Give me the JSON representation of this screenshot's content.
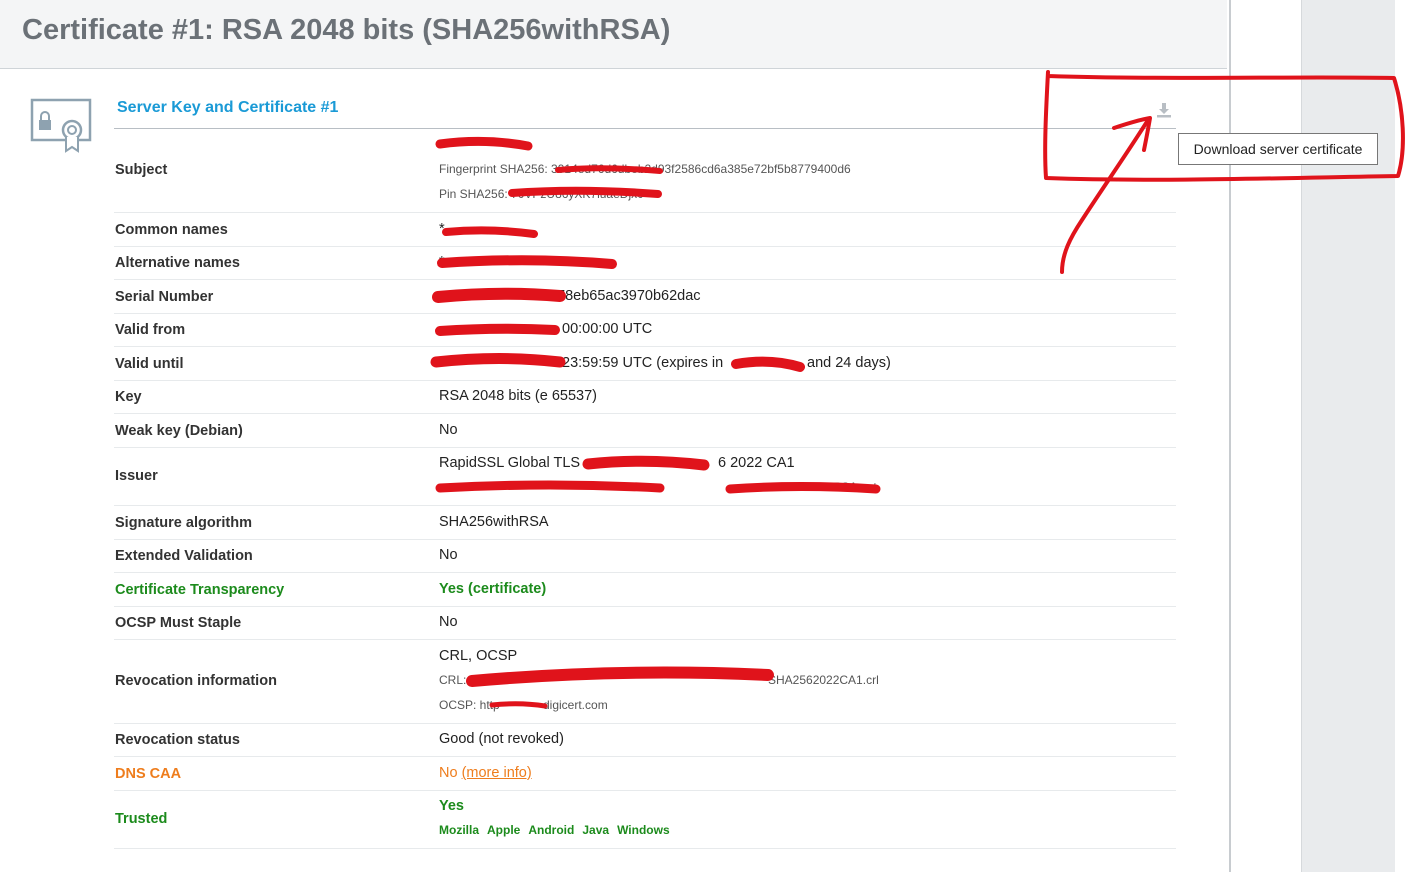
{
  "header": {
    "title": "Certificate #1: RSA 2048 bits (SHA256withRSA)"
  },
  "section": {
    "title": "Server Key and Certificate #1",
    "download_tooltip": "Download server certificate",
    "download_icon": "download-icon",
    "cert_icon": "certificate-icon"
  },
  "rows": {
    "subject": {
      "label": "Subject",
      "value": "",
      "fingerprint": "Fingerprint SHA256: 3914ed76d6dbeb2d93f2586cd6a385e72bf5b8779400d6",
      "pin": "Pin SHA256: 70VPzU86yXK7iuaeDjx0="
    },
    "common_names": {
      "label": "Common names",
      "value": "*."
    },
    "alt_names": {
      "label": "Alternative names",
      "value": "*"
    },
    "serial": {
      "label": "Serial Number",
      "value": "78eb65ac3970b62dac"
    },
    "valid_from": {
      "label": "Valid from",
      "value": "00:00:00 UTC"
    },
    "valid_until": {
      "label": "Valid until",
      "value": "23:59:59 UTC (expires in",
      "tail": "and 24 days)"
    },
    "key": {
      "label": "Key",
      "value": "RSA 2048 bits (e 65537)"
    },
    "weak_key": {
      "label": "Weak key (Debian)",
      "value": "No"
    },
    "issuer": {
      "label": "Issuer",
      "value": "RapidSSL Global TLS",
      "value_tail": "6 2022 CA1",
      "aia": "GlobalTLSRSA .crt"
    },
    "sig_alg": {
      "label": "Signature algorithm",
      "value": "SHA256withRSA"
    },
    "ev": {
      "label": "Extended Validation",
      "value": "No"
    },
    "ct": {
      "label": "Certificate Transparency",
      "value": "Yes (certificate)"
    },
    "ocsp_staple": {
      "label": "OCSP Must Staple",
      "value": "No"
    },
    "revocation_info": {
      "label": "Revocation information",
      "value": "CRL, OCSP",
      "crl": "CRL:",
      "crl_tail": "SHA2562022CA1.crl",
      "ocsp": "OCSP: http",
      "ocsp_tail": "digicert.com"
    },
    "revocation_status": {
      "label": "Revocation status",
      "value": "Good (not revoked)"
    },
    "dns_caa": {
      "label": "DNS CAA",
      "value": "No",
      "link": "(more info)"
    },
    "trusted": {
      "label": "Trusted",
      "value": "Yes",
      "stores": [
        "Mozilla",
        "Apple",
        "Android",
        "Java",
        "Windows"
      ]
    }
  },
  "colors": {
    "accent": "#1a9ad6",
    "good": "#1c8b1c",
    "warning": "#ee7d1d",
    "annotation": "#e0131b"
  }
}
